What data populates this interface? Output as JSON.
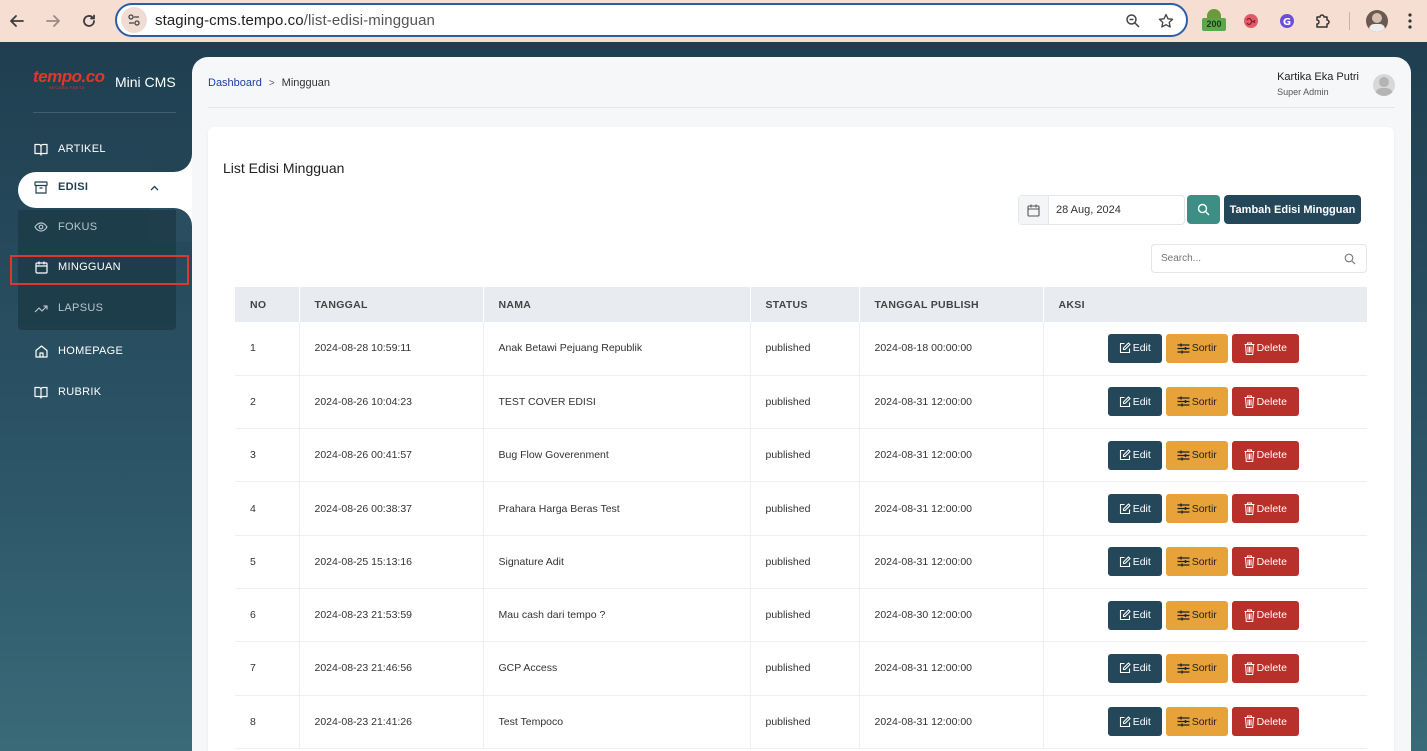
{
  "browser": {
    "url_host": "staging-cms.tempo.co",
    "url_path": "/list-edisi-mingguan",
    "ext_badge": "200"
  },
  "sidebar": {
    "logo_text": "tempo.co",
    "logo_sub": "SECARA FAKTA",
    "app_name": "Mini CMS",
    "items": [
      {
        "label": "ARTIKEL"
      },
      {
        "label": "EDISI"
      },
      {
        "label": "HOMEPAGE"
      },
      {
        "label": "RUBRIK"
      }
    ],
    "submenu": [
      {
        "label": "FOKUS"
      },
      {
        "label": "MINGGUAN"
      },
      {
        "label": "LAPSUS"
      }
    ]
  },
  "header": {
    "breadcrumb_root": "Dashboard",
    "breadcrumb_current": "Mingguan",
    "user_name": "Kartika Eka Putri",
    "user_role": "Super Admin"
  },
  "main": {
    "title": "List Edisi Mingguan",
    "date_value": "28 Aug, 2024",
    "add_label": "Tambah Edisi Mingguan",
    "search_placeholder": "Search..."
  },
  "table": {
    "columns": [
      "NO",
      "TANGGAL",
      "NAMA",
      "STATUS",
      "TANGGAL PUBLISH",
      "AKSI"
    ],
    "rows": [
      [
        "1",
        "2024-08-28 10:59:11",
        "Anak Betawi Pejuang Republik",
        "published",
        "2024-08-18 00:00:00"
      ],
      [
        "2",
        "2024-08-26 10:04:23",
        "TEST COVER EDISI",
        "published",
        "2024-08-31 12:00:00"
      ],
      [
        "3",
        "2024-08-26 00:41:57",
        "Bug Flow Goverenment",
        "published",
        "2024-08-31 12:00:00"
      ],
      [
        "4",
        "2024-08-26 00:38:37",
        "Prahara Harga Beras Test",
        "published",
        "2024-08-31 12:00:00"
      ],
      [
        "5",
        "2024-08-25 15:13:16",
        "Signature Adit",
        "published",
        "2024-08-31 12:00:00"
      ],
      [
        "6",
        "2024-08-23 21:53:59",
        "Mau cash dari tempo ?",
        "published",
        "2024-08-30 12:00:00"
      ],
      [
        "7",
        "2024-08-23 21:46:56",
        "GCP Access",
        "published",
        "2024-08-31 12:00:00"
      ],
      [
        "8",
        "2024-08-23 21:41:26",
        "Test Tempoco",
        "published",
        "2024-08-31 12:00:00"
      ]
    ],
    "actions": {
      "edit": "Edit",
      "sort": "Sortir",
      "delete": "Delete"
    }
  },
  "colors": {
    "sidebar_dark": "#1f3f50",
    "primary": "#25475a",
    "teal": "#3d8e84",
    "warning": "#e8a23a",
    "danger": "#b8302a",
    "brand_red": "#e0372b"
  }
}
